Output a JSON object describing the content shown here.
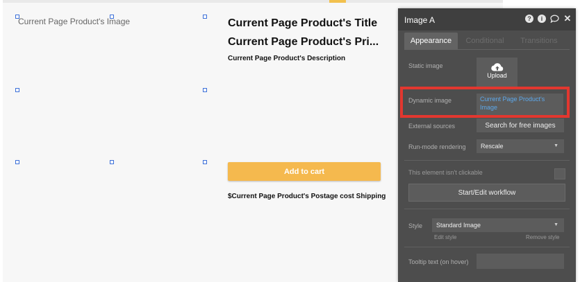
{
  "canvas": {
    "image_placeholder": "Current Page Product's Image",
    "title": "Current Page Product's Title",
    "price": "Current Page Product's Pri...",
    "description": "Current Page Product's Description",
    "add_to_cart": "Add to cart",
    "postage": "$Current Page Product's Postage cost Shipping"
  },
  "panel": {
    "title": "Image A",
    "header_icons": [
      "help-icon",
      "info-icon",
      "comment-icon",
      "close-icon"
    ],
    "tabs": [
      "Appearance",
      "Conditional",
      "Transitions"
    ],
    "static_image_label": "Static image",
    "upload_label": "Upload",
    "dynamic_image_label": "Dynamic image",
    "dynamic_image_value": "Current Page Product's Image",
    "external_sources_label": "External sources",
    "search_free_images": "Search for free images",
    "run_mode_label": "Run-mode rendering",
    "run_mode_value": "Rescale",
    "not_clickable_label": "This element isn't clickable",
    "workflow_button": "Start/Edit workflow",
    "style_label": "Style",
    "style_value": "Standard Image",
    "edit_style": "Edit style",
    "remove_style": "Remove style",
    "tooltip_label": "Tooltip text (on hover)"
  },
  "colors": {
    "accent": "#f5b94e",
    "panel_bg": "#4d4d4d",
    "highlight": "#e2372f",
    "dynamic_text": "#5da9ec",
    "selection_handle": "#3b6fd8"
  }
}
